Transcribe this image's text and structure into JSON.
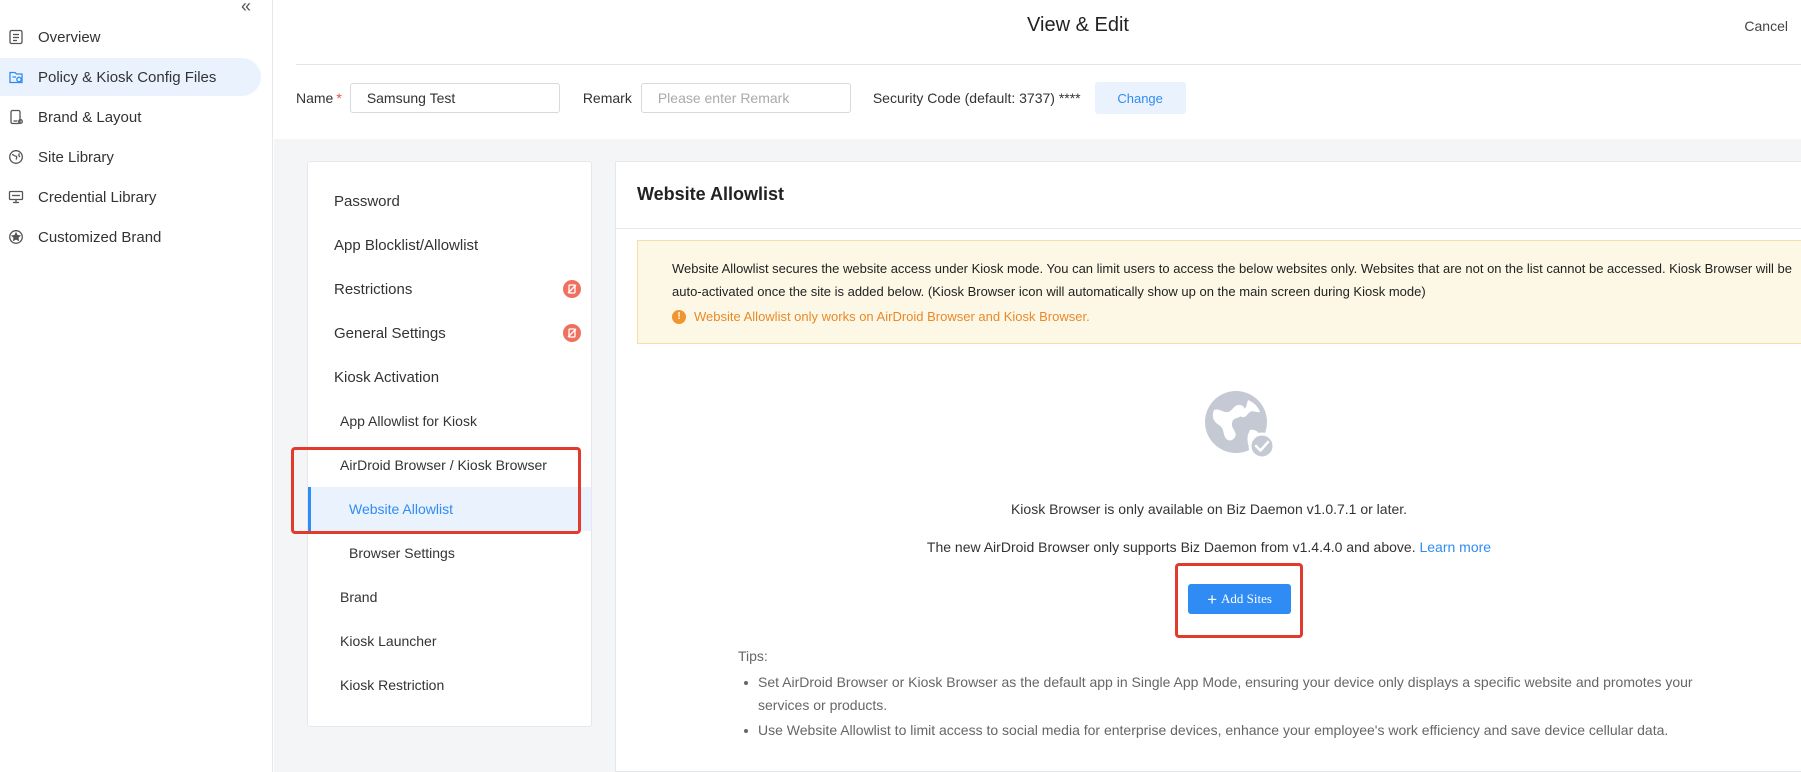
{
  "sidebar": {
    "items": [
      {
        "label": "Overview",
        "icon": "document-icon"
      },
      {
        "label": "Policy & Kiosk Config Files",
        "icon": "policy-file-icon"
      },
      {
        "label": "Brand & Layout",
        "icon": "brand-layout-icon"
      },
      {
        "label": "Site Library",
        "icon": "globe-icon"
      },
      {
        "label": "Credential Library",
        "icon": "credential-icon"
      },
      {
        "label": "Customized Brand",
        "icon": "star-icon"
      }
    ],
    "active_index": 1
  },
  "header": {
    "title": "View & Edit",
    "cancel_label": "Cancel"
  },
  "form": {
    "name_label": "Name",
    "required_mark": "*",
    "name_value": "Samsung Test",
    "remark_label": "Remark",
    "remark_placeholder": "Please enter Remark",
    "security_label": "Security Code (default: 3737) ****",
    "change_label": "Change"
  },
  "submenu": {
    "items": [
      {
        "label": "Password",
        "badge": false
      },
      {
        "label": "App Blocklist/Allowlist",
        "badge": false
      },
      {
        "label": "Restrictions",
        "badge": true
      },
      {
        "label": "General Settings",
        "badge": true
      },
      {
        "label": "Kiosk Activation",
        "badge": false
      },
      {
        "label": "App Allowlist for Kiosk",
        "badge": false
      },
      {
        "label": "AirDroid Browser / Kiosk Browser",
        "badge": false
      },
      {
        "label": "Website Allowlist",
        "badge": false,
        "active": true
      },
      {
        "label": "Browser Settings",
        "badge": false
      },
      {
        "label": "Brand",
        "badge": false
      },
      {
        "label": "Kiosk Launcher",
        "badge": false
      },
      {
        "label": "Kiosk Restriction",
        "badge": false
      }
    ]
  },
  "main": {
    "section_title": "Website Allowlist",
    "notice_text": "Website Allowlist secures the website access under Kiosk mode. You can limit users to access the below websites only. Websites that are not on the list cannot be accessed. Kiosk Browser will be auto-activated once the site is added below. (Kiosk Browser icon will automatically show up on the main screen during Kiosk mode)",
    "notice_warning": "Website Allowlist only works on AirDroid Browser and Kiosk Browser.",
    "empty_icon": "globe-check-icon",
    "availability_text": "Kiosk Browser is only available on Biz Daemon v1.0.7.1 or later.",
    "support_text": "The new AirDroid Browser only supports Biz Daemon from v1.4.4.0 and above.",
    "learn_more": "Learn more",
    "add_sites_label": "Add Sites",
    "tips_title": "Tips:",
    "tips": [
      "Set AirDroid Browser or Kiosk Browser as the default app in Single App Mode, ensuring your device only displays a specific website and promotes your services or products.",
      "Use Website Allowlist to limit access to social media for enterprise devices, enhance your employee's work efficiency and save device cellular data."
    ]
  },
  "colors": {
    "accent": "#2f8cf4",
    "active_bg": "#eaf2fe",
    "badge": "#f07060",
    "notice_bg": "#fdf8e6",
    "warning": "#e8892a",
    "highlight": "#e23b2e"
  }
}
